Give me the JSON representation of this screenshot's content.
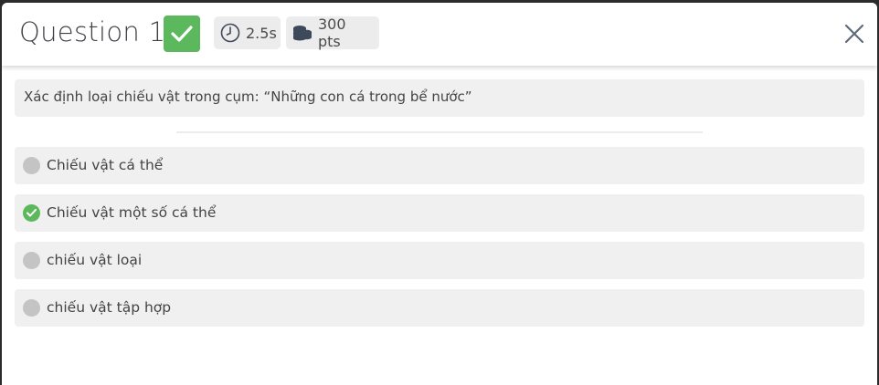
{
  "header": {
    "title": "Question 1",
    "status": "correct",
    "time": "2.5s",
    "points": "300 pts"
  },
  "question": {
    "text": "Xác định loại chiếu vật trong cụm: “Những con cá trong bể nước”"
  },
  "options": [
    {
      "label": "Chiếu vật cá thể",
      "correct": false
    },
    {
      "label": "Chiếu vật một số cá thể",
      "correct": true
    },
    {
      "label": "chiếu vật loại",
      "correct": false
    },
    {
      "label": "chiếu vật tập hợp",
      "correct": false
    }
  ],
  "colors": {
    "correct": "#5cb85c",
    "neutral_dot": "#c4c4c4",
    "panel_bg": "#f0f0f0"
  },
  "icons": {
    "correct_badge": "checkmark-icon",
    "time": "clock-icon",
    "points": "coins-icon",
    "close": "close-icon"
  }
}
